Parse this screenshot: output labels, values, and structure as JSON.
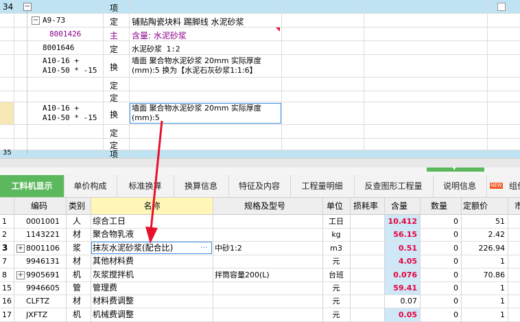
{
  "top": {
    "rows": [
      {
        "rownum": "34",
        "code": "",
        "type": "项",
        "name": "",
        "tag": "−"
      },
      {
        "rownum": "",
        "code": "A9-73",
        "type": "定",
        "name": "铺贴陶瓷块料 踢脚线 水泥砂浆",
        "tag": "−"
      },
      {
        "rownum": "",
        "code": "8001426",
        "type": "主",
        "name": "含量: 水泥砂浆",
        "tag": ""
      },
      {
        "rownum": "",
        "code": "8001646",
        "type": "定",
        "name": "水泥砂浆 1:2",
        "tag": ""
      },
      {
        "rownum": "",
        "code": "A10-16 +\nA10-50 * -15",
        "type": "换",
        "name": "墙面 聚合物水泥砂浆 20mm 实际厚度\n(mm):5 换为【水泥石灰砂浆1:1:6】",
        "tag": ""
      },
      {
        "rownum": "",
        "code": "",
        "type": "定",
        "name": "",
        "tag": ""
      },
      {
        "rownum": "",
        "code": "",
        "type": "定",
        "name": "",
        "tag": ""
      },
      {
        "rownum": "",
        "code": "A10-16 +\nA10-50 * -15",
        "type": "换",
        "name": "墙面 聚合物水泥砂浆 20mm 实际厚度\n(mm):5",
        "tag": ""
      },
      {
        "rownum": "",
        "code": "",
        "type": "定",
        "name": "",
        "tag": ""
      },
      {
        "rownum": "",
        "code": "",
        "type": "定",
        "name": "",
        "tag": ""
      },
      {
        "rownum": "35",
        "code": "",
        "type": "项",
        "name": "",
        "tag": ""
      }
    ]
  },
  "tabs": [
    "工料机显示",
    "单价构成",
    "标准换算",
    "换算信息",
    "特征及内容",
    "工程量明细",
    "反查图形工程量",
    "说明信息",
    "组价"
  ],
  "tabs_new_badge": "NEW",
  "grid": {
    "headers": [
      "编码",
      "类别",
      "名称",
      "规格及型号",
      "单位",
      "损耗率",
      "含量",
      "数量",
      "定额价",
      "市"
    ],
    "rows": [
      {
        "idx": "1",
        "code": "0001001",
        "cat": "人",
        "name": "综合工日",
        "spec": "",
        "unit": "工日",
        "loss": "",
        "qty": "10.412",
        "amount": "0",
        "price": "51",
        "expand": false
      },
      {
        "idx": "2",
        "code": "1143221",
        "cat": "材",
        "name": "聚合物乳液",
        "spec": "",
        "unit": "kg",
        "loss": "",
        "qty": "56.15",
        "amount": "0",
        "price": "2.42",
        "expand": false
      },
      {
        "idx": "3",
        "code": "8001106",
        "cat": "浆",
        "name": "抹灰水泥砂浆(配合比)",
        "spec": "中砂1:2",
        "unit": "m3",
        "loss": "",
        "qty": "0.51",
        "amount": "0",
        "price": "226.94",
        "expand": true
      },
      {
        "idx": "7",
        "code": "9946131",
        "cat": "材",
        "name": "其他材料费",
        "spec": "",
        "unit": "元",
        "loss": "",
        "qty": "4.05",
        "amount": "0",
        "price": "1",
        "expand": false
      },
      {
        "idx": "8",
        "code": "9905691",
        "cat": "机",
        "name": "灰浆搅拌机",
        "spec": "拌筒容量200(L)",
        "unit": "台班",
        "loss": "",
        "qty": "0.076",
        "amount": "0",
        "price": "70.86",
        "expand": true
      },
      {
        "idx": "15",
        "code": "9946605",
        "cat": "管",
        "name": "管理费",
        "spec": "",
        "unit": "元",
        "loss": "",
        "qty": "59.41",
        "amount": "0",
        "price": "1",
        "expand": false
      },
      {
        "idx": "16",
        "code": "CLFTZ",
        "cat": "材",
        "name": "材料费调整",
        "spec": "",
        "unit": "元",
        "loss": "",
        "qty": "0.07",
        "amount": "0",
        "price": "1",
        "expand": false
      },
      {
        "idx": "17",
        "code": "JXFTZ",
        "cat": "机",
        "name": "机械费调整",
        "spec": "",
        "unit": "元",
        "loss": "",
        "qty": "0.05",
        "amount": "0",
        "price": "1",
        "expand": false
      }
    ]
  },
  "colors": {
    "accent_green": "#5cb85c",
    "row_highlight": "#bfe3f2",
    "qty_red": "#e6003c",
    "arrow_red": "#e8102a"
  }
}
